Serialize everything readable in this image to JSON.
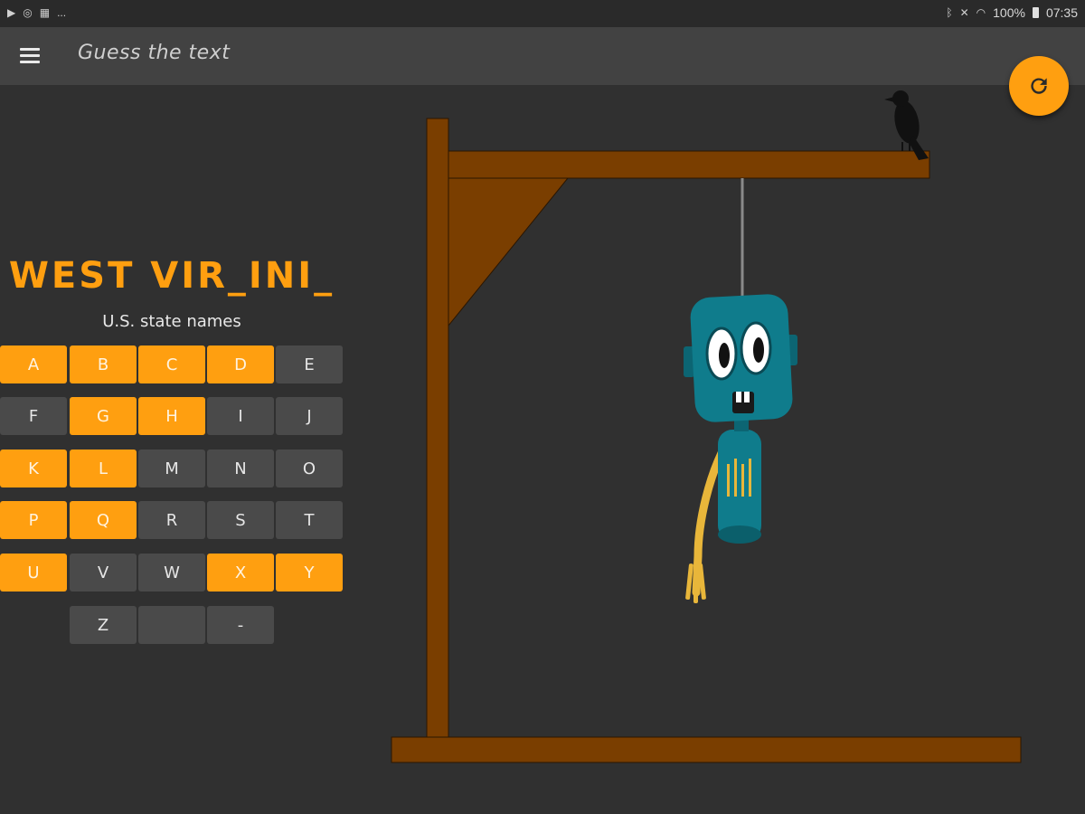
{
  "status_bar": {
    "left_icons": [
      "play-icon",
      "target-icon",
      "calendar-icon"
    ],
    "more": "...",
    "right_icons": [
      "bluetooth-icon",
      "mute-icon",
      "wifi-icon"
    ],
    "battery": "100%",
    "time": "07:35"
  },
  "app_bar": {
    "title": "Guess the text",
    "menu_icon": "hamburger-menu-icon"
  },
  "fab": {
    "icon": "refresh-icon"
  },
  "puzzle": {
    "word": "WEST VIR_INI_",
    "category": "U.S. state names"
  },
  "keyboard": {
    "rows": [
      [
        {
          "label": "A",
          "used": true
        },
        {
          "label": "B",
          "used": true
        },
        {
          "label": "C",
          "used": true
        },
        {
          "label": "D",
          "used": true
        },
        {
          "label": "E",
          "used": false
        }
      ],
      [
        {
          "label": "F",
          "used": false
        },
        {
          "label": "G",
          "used": true
        },
        {
          "label": "H",
          "used": true
        },
        {
          "label": "I",
          "used": false
        },
        {
          "label": "J",
          "used": false
        }
      ],
      [
        {
          "label": "K",
          "used": true
        },
        {
          "label": "L",
          "used": true
        },
        {
          "label": "M",
          "used": false
        },
        {
          "label": "N",
          "used": false
        },
        {
          "label": "O",
          "used": false
        }
      ],
      [
        {
          "label": "P",
          "used": true
        },
        {
          "label": "Q",
          "used": true
        },
        {
          "label": "R",
          "used": false
        },
        {
          "label": "S",
          "used": false
        },
        {
          "label": "T",
          "used": false
        }
      ],
      [
        {
          "label": "U",
          "used": true
        },
        {
          "label": "V",
          "used": false
        },
        {
          "label": "W",
          "used": false
        },
        {
          "label": "X",
          "used": true
        },
        {
          "label": "Y",
          "used": true
        }
      ],
      [
        {
          "label": "Z",
          "used": false
        },
        {
          "label": "",
          "used": false
        },
        {
          "label": "-",
          "used": false
        }
      ]
    ]
  },
  "colors": {
    "accent": "#ff9f10",
    "background": "#303030",
    "app_bar": "#424242",
    "key_free": "#4a4a4a",
    "wood": "#7a3e00",
    "robot_body": "#0f7c8c",
    "arm": "#e8b63a"
  }
}
